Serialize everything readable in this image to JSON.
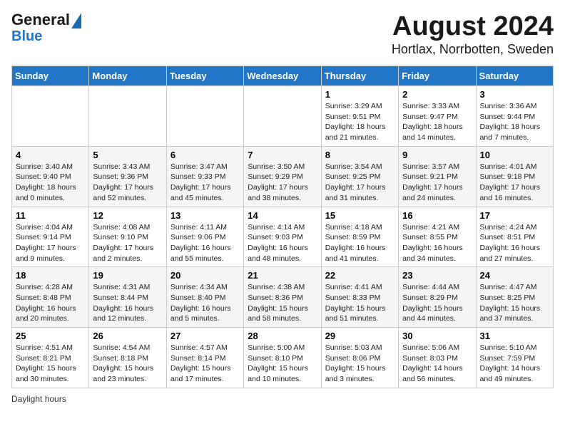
{
  "header": {
    "logo_line1": "General",
    "logo_line2": "Blue",
    "title": "August 2024",
    "subtitle": "Hortlax, Norrbotten, Sweden"
  },
  "days_of_week": [
    "Sunday",
    "Monday",
    "Tuesday",
    "Wednesday",
    "Thursday",
    "Friday",
    "Saturday"
  ],
  "weeks": [
    [
      {
        "day": "",
        "info": ""
      },
      {
        "day": "",
        "info": ""
      },
      {
        "day": "",
        "info": ""
      },
      {
        "day": "",
        "info": ""
      },
      {
        "day": "1",
        "info": "Sunrise: 3:29 AM\nSunset: 9:51 PM\nDaylight: 18 hours\nand 21 minutes."
      },
      {
        "day": "2",
        "info": "Sunrise: 3:33 AM\nSunset: 9:47 PM\nDaylight: 18 hours\nand 14 minutes."
      },
      {
        "day": "3",
        "info": "Sunrise: 3:36 AM\nSunset: 9:44 PM\nDaylight: 18 hours\nand 7 minutes."
      }
    ],
    [
      {
        "day": "4",
        "info": "Sunrise: 3:40 AM\nSunset: 9:40 PM\nDaylight: 18 hours\nand 0 minutes."
      },
      {
        "day": "5",
        "info": "Sunrise: 3:43 AM\nSunset: 9:36 PM\nDaylight: 17 hours\nand 52 minutes."
      },
      {
        "day": "6",
        "info": "Sunrise: 3:47 AM\nSunset: 9:33 PM\nDaylight: 17 hours\nand 45 minutes."
      },
      {
        "day": "7",
        "info": "Sunrise: 3:50 AM\nSunset: 9:29 PM\nDaylight: 17 hours\nand 38 minutes."
      },
      {
        "day": "8",
        "info": "Sunrise: 3:54 AM\nSunset: 9:25 PM\nDaylight: 17 hours\nand 31 minutes."
      },
      {
        "day": "9",
        "info": "Sunrise: 3:57 AM\nSunset: 9:21 PM\nDaylight: 17 hours\nand 24 minutes."
      },
      {
        "day": "10",
        "info": "Sunrise: 4:01 AM\nSunset: 9:18 PM\nDaylight: 17 hours\nand 16 minutes."
      }
    ],
    [
      {
        "day": "11",
        "info": "Sunrise: 4:04 AM\nSunset: 9:14 PM\nDaylight: 17 hours\nand 9 minutes."
      },
      {
        "day": "12",
        "info": "Sunrise: 4:08 AM\nSunset: 9:10 PM\nDaylight: 17 hours\nand 2 minutes."
      },
      {
        "day": "13",
        "info": "Sunrise: 4:11 AM\nSunset: 9:06 PM\nDaylight: 16 hours\nand 55 minutes."
      },
      {
        "day": "14",
        "info": "Sunrise: 4:14 AM\nSunset: 9:03 PM\nDaylight: 16 hours\nand 48 minutes."
      },
      {
        "day": "15",
        "info": "Sunrise: 4:18 AM\nSunset: 8:59 PM\nDaylight: 16 hours\nand 41 minutes."
      },
      {
        "day": "16",
        "info": "Sunrise: 4:21 AM\nSunset: 8:55 PM\nDaylight: 16 hours\nand 34 minutes."
      },
      {
        "day": "17",
        "info": "Sunrise: 4:24 AM\nSunset: 8:51 PM\nDaylight: 16 hours\nand 27 minutes."
      }
    ],
    [
      {
        "day": "18",
        "info": "Sunrise: 4:28 AM\nSunset: 8:48 PM\nDaylight: 16 hours\nand 20 minutes."
      },
      {
        "day": "19",
        "info": "Sunrise: 4:31 AM\nSunset: 8:44 PM\nDaylight: 16 hours\nand 12 minutes."
      },
      {
        "day": "20",
        "info": "Sunrise: 4:34 AM\nSunset: 8:40 PM\nDaylight: 16 hours\nand 5 minutes."
      },
      {
        "day": "21",
        "info": "Sunrise: 4:38 AM\nSunset: 8:36 PM\nDaylight: 15 hours\nand 58 minutes."
      },
      {
        "day": "22",
        "info": "Sunrise: 4:41 AM\nSunset: 8:33 PM\nDaylight: 15 hours\nand 51 minutes."
      },
      {
        "day": "23",
        "info": "Sunrise: 4:44 AM\nSunset: 8:29 PM\nDaylight: 15 hours\nand 44 minutes."
      },
      {
        "day": "24",
        "info": "Sunrise: 4:47 AM\nSunset: 8:25 PM\nDaylight: 15 hours\nand 37 minutes."
      }
    ],
    [
      {
        "day": "25",
        "info": "Sunrise: 4:51 AM\nSunset: 8:21 PM\nDaylight: 15 hours\nand 30 minutes."
      },
      {
        "day": "26",
        "info": "Sunrise: 4:54 AM\nSunset: 8:18 PM\nDaylight: 15 hours\nand 23 minutes."
      },
      {
        "day": "27",
        "info": "Sunrise: 4:57 AM\nSunset: 8:14 PM\nDaylight: 15 hours\nand 17 minutes."
      },
      {
        "day": "28",
        "info": "Sunrise: 5:00 AM\nSunset: 8:10 PM\nDaylight: 15 hours\nand 10 minutes."
      },
      {
        "day": "29",
        "info": "Sunrise: 5:03 AM\nSunset: 8:06 PM\nDaylight: 15 hours\nand 3 minutes."
      },
      {
        "day": "30",
        "info": "Sunrise: 5:06 AM\nSunset: 8:03 PM\nDaylight: 14 hours\nand 56 minutes."
      },
      {
        "day": "31",
        "info": "Sunrise: 5:10 AM\nSunset: 7:59 PM\nDaylight: 14 hours\nand 49 minutes."
      }
    ]
  ],
  "footer": {
    "daylight_label": "Daylight hours"
  }
}
